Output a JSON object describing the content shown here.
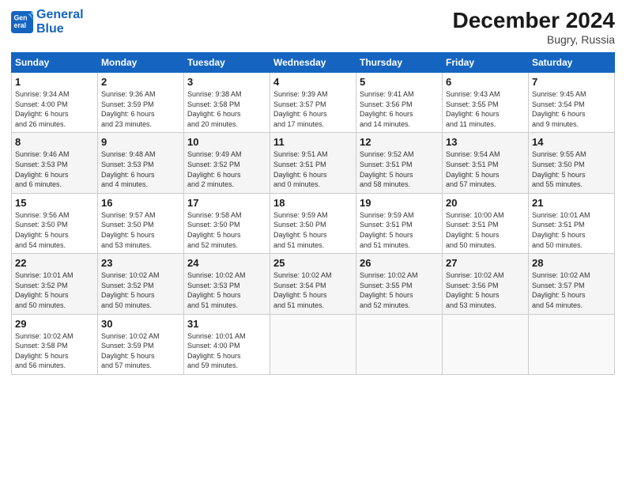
{
  "logo": {
    "line1": "General",
    "line2": "Blue"
  },
  "title": "December 2024",
  "subtitle": "Bugry, Russia",
  "weekdays": [
    "Sunday",
    "Monday",
    "Tuesday",
    "Wednesday",
    "Thursday",
    "Friday",
    "Saturday"
  ],
  "weeks": [
    [
      {
        "day": "1",
        "info": "Sunrise: 9:34 AM\nSunset: 4:00 PM\nDaylight: 6 hours\nand 26 minutes."
      },
      {
        "day": "2",
        "info": "Sunrise: 9:36 AM\nSunset: 3:59 PM\nDaylight: 6 hours\nand 23 minutes."
      },
      {
        "day": "3",
        "info": "Sunrise: 9:38 AM\nSunset: 3:58 PM\nDaylight: 6 hours\nand 20 minutes."
      },
      {
        "day": "4",
        "info": "Sunrise: 9:39 AM\nSunset: 3:57 PM\nDaylight: 6 hours\nand 17 minutes."
      },
      {
        "day": "5",
        "info": "Sunrise: 9:41 AM\nSunset: 3:56 PM\nDaylight: 6 hours\nand 14 minutes."
      },
      {
        "day": "6",
        "info": "Sunrise: 9:43 AM\nSunset: 3:55 PM\nDaylight: 6 hours\nand 11 minutes."
      },
      {
        "day": "7",
        "info": "Sunrise: 9:45 AM\nSunset: 3:54 PM\nDaylight: 6 hours\nand 9 minutes."
      }
    ],
    [
      {
        "day": "8",
        "info": "Sunrise: 9:46 AM\nSunset: 3:53 PM\nDaylight: 6 hours\nand 6 minutes."
      },
      {
        "day": "9",
        "info": "Sunrise: 9:48 AM\nSunset: 3:53 PM\nDaylight: 6 hours\nand 4 minutes."
      },
      {
        "day": "10",
        "info": "Sunrise: 9:49 AM\nSunset: 3:52 PM\nDaylight: 6 hours\nand 2 minutes."
      },
      {
        "day": "11",
        "info": "Sunrise: 9:51 AM\nSunset: 3:51 PM\nDaylight: 6 hours\nand 0 minutes."
      },
      {
        "day": "12",
        "info": "Sunrise: 9:52 AM\nSunset: 3:51 PM\nDaylight: 5 hours\nand 58 minutes."
      },
      {
        "day": "13",
        "info": "Sunrise: 9:54 AM\nSunset: 3:51 PM\nDaylight: 5 hours\nand 57 minutes."
      },
      {
        "day": "14",
        "info": "Sunrise: 9:55 AM\nSunset: 3:50 PM\nDaylight: 5 hours\nand 55 minutes."
      }
    ],
    [
      {
        "day": "15",
        "info": "Sunrise: 9:56 AM\nSunset: 3:50 PM\nDaylight: 5 hours\nand 54 minutes."
      },
      {
        "day": "16",
        "info": "Sunrise: 9:57 AM\nSunset: 3:50 PM\nDaylight: 5 hours\nand 53 minutes."
      },
      {
        "day": "17",
        "info": "Sunrise: 9:58 AM\nSunset: 3:50 PM\nDaylight: 5 hours\nand 52 minutes."
      },
      {
        "day": "18",
        "info": "Sunrise: 9:59 AM\nSunset: 3:50 PM\nDaylight: 5 hours\nand 51 minutes."
      },
      {
        "day": "19",
        "info": "Sunrise: 9:59 AM\nSunset: 3:51 PM\nDaylight: 5 hours\nand 51 minutes."
      },
      {
        "day": "20",
        "info": "Sunrise: 10:00 AM\nSunset: 3:51 PM\nDaylight: 5 hours\nand 50 minutes."
      },
      {
        "day": "21",
        "info": "Sunrise: 10:01 AM\nSunset: 3:51 PM\nDaylight: 5 hours\nand 50 minutes."
      }
    ],
    [
      {
        "day": "22",
        "info": "Sunrise: 10:01 AM\nSunset: 3:52 PM\nDaylight: 5 hours\nand 50 minutes."
      },
      {
        "day": "23",
        "info": "Sunrise: 10:02 AM\nSunset: 3:52 PM\nDaylight: 5 hours\nand 50 minutes."
      },
      {
        "day": "24",
        "info": "Sunrise: 10:02 AM\nSunset: 3:53 PM\nDaylight: 5 hours\nand 51 minutes."
      },
      {
        "day": "25",
        "info": "Sunrise: 10:02 AM\nSunset: 3:54 PM\nDaylight: 5 hours\nand 51 minutes."
      },
      {
        "day": "26",
        "info": "Sunrise: 10:02 AM\nSunset: 3:55 PM\nDaylight: 5 hours\nand 52 minutes."
      },
      {
        "day": "27",
        "info": "Sunrise: 10:02 AM\nSunset: 3:56 PM\nDaylight: 5 hours\nand 53 minutes."
      },
      {
        "day": "28",
        "info": "Sunrise: 10:02 AM\nSunset: 3:57 PM\nDaylight: 5 hours\nand 54 minutes."
      }
    ],
    [
      {
        "day": "29",
        "info": "Sunrise: 10:02 AM\nSunset: 3:58 PM\nDaylight: 5 hours\nand 56 minutes."
      },
      {
        "day": "30",
        "info": "Sunrise: 10:02 AM\nSunset: 3:59 PM\nDaylight: 5 hours\nand 57 minutes."
      },
      {
        "day": "31",
        "info": "Sunrise: 10:01 AM\nSunset: 4:00 PM\nDaylight: 5 hours\nand 59 minutes."
      },
      null,
      null,
      null,
      null
    ]
  ]
}
